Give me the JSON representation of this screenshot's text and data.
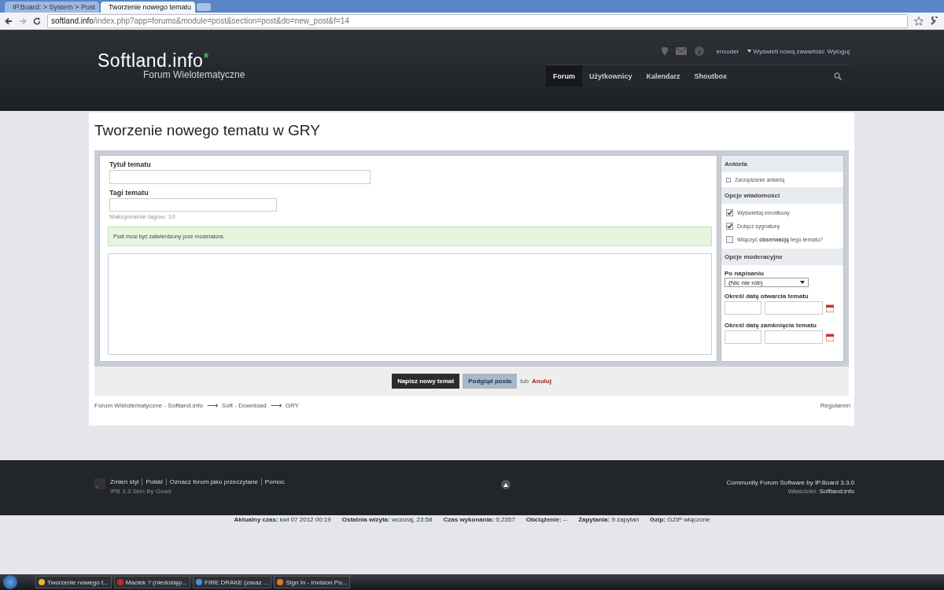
{
  "browser": {
    "tabs": [
      {
        "title": "IP.Board: > System > Post",
        "selected": false
      },
      {
        "title": "Tworzenie nowego tematu",
        "selected": true
      }
    ],
    "url_host": "softland.info",
    "url_path": "/index.php?app=forums&module=post&section=post&do=new_post&f=14"
  },
  "header": {
    "logo": "Softland.info",
    "logo_mark": "*",
    "tagline": "Forum Wielotematyczne",
    "user": "encoder",
    "user_links": [
      "Wyświetl nową zawartość",
      "Wyloguj"
    ],
    "nav": [
      {
        "label": "Forum",
        "selected": true
      },
      {
        "label": "Użytkownicy",
        "selected": false
      },
      {
        "label": "Kalendarz",
        "selected": false
      },
      {
        "label": "Shoutbox",
        "selected": false
      }
    ]
  },
  "page_title": "Tworzenie nowego tematu w GRY",
  "form": {
    "title_label": "Tytuł tematu",
    "tags_label": "Tagi tematu",
    "tags_hint": "Maksymalnie tagów: 10",
    "notice": "Post musi być zatwierdzony prze moderatora."
  },
  "sidebar": {
    "poll_heading": "Ankieta",
    "poll_link": "Zarządzanie ankietą",
    "message_heading": "Opcje wiadomości",
    "options": [
      {
        "label": "Wyświetlaj emotikony",
        "checked": true
      },
      {
        "label": "Dołącz sygnaturę",
        "checked": true
      },
      {
        "label": "Włączyć **obserwację** tego tematu?",
        "checked": false
      }
    ],
    "mod_heading": "Opcje moderacyjne",
    "after_label": "Po napisaniu",
    "after_value": "(Nic nie rób)",
    "open_label": "Określ datę otwarcia tematu",
    "close_label": "Określ datę zamknięcia tematu"
  },
  "actions": {
    "submit": "Napisz nowy temat",
    "preview": "Podgląd posta",
    "or": "lub",
    "cancel": "Anuluj"
  },
  "breadcrumb": [
    "Forum Wielotematyczne - Softland.info",
    "Soft - Download",
    "GRY"
  ],
  "breadcrumb_sep": "⟶",
  "rules": "Regulamin",
  "footer": {
    "links": [
      "Zmień styl",
      "Polski",
      "Oznacz forum jako przeczytane",
      "Pomoc"
    ],
    "skin": "IPB 3.3 Skin By Goad",
    "credit": "Community Forum Software by IP.Board 3.3.0",
    "owner_label": "Właściciel:",
    "owner": "Softland.info"
  },
  "stats": [
    {
      "label": "Aktualny czas:",
      "value": "kwi 07 2012 00:19"
    },
    {
      "label": "Ostatnia wizyta:",
      "value": "wczoraj, 23:58"
    },
    {
      "label": "Czas wykonania:",
      "value": "0,2357"
    },
    {
      "label": "Obciążenie:",
      "value": "--"
    },
    {
      "label": "Zapytania:",
      "value": "9 zapytań"
    },
    {
      "label": "Gzip:",
      "value": "GZIP włączone"
    }
  ],
  "taskbar": [
    "Tworzenie nowego t...",
    "Maciek ? (niedostęp...",
    "FIRE DRAKE (zaraz ...",
    "Sign In - Invision Po..."
  ]
}
